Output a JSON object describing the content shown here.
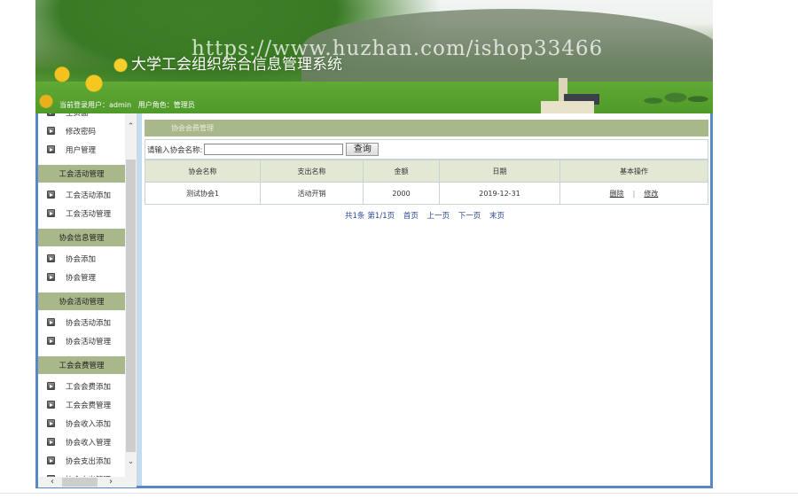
{
  "header": {
    "title": "大学工会组织综合信息管理系统",
    "watermark": "https://www.huzhan.com/ishop33466",
    "user_label": "当前登录用户：",
    "user_name": "admin",
    "role_label": "用户角色：",
    "role_name": "管理员"
  },
  "sidebar": {
    "partial_item": "主页面",
    "groups": [
      {
        "title": null,
        "items": [
          "修改密码",
          "用户管理"
        ]
      },
      {
        "title": "工会活动管理",
        "items": [
          "工会活动添加",
          "工会活动管理"
        ]
      },
      {
        "title": "协会信息管理",
        "items": [
          "协会添加",
          "协会管理"
        ]
      },
      {
        "title": "协会活动管理",
        "items": [
          "协会活动添加",
          "协会活动管理"
        ]
      },
      {
        "title": "工会会费管理",
        "items": [
          "工会会费添加",
          "工会会费管理",
          "协会收入添加",
          "协会收入管理",
          "协会支出添加",
          "协会支出管理"
        ]
      }
    ]
  },
  "main": {
    "panel_title": "协会会费管理",
    "search": {
      "label": "请输入协会名称:",
      "value": "",
      "button": "查询"
    },
    "table": {
      "columns": [
        "协会名称",
        "支出名称",
        "金额",
        "日期",
        "基本操作"
      ],
      "rows": [
        {
          "association": "测试协会1",
          "expense": "活动开销",
          "amount": "2000",
          "date": "2019-12-31",
          "delete": "删除",
          "separator": "|",
          "edit": "修改"
        }
      ]
    },
    "pager": {
      "total": "共1条",
      "page": "第1/1页",
      "first": "首页",
      "prev": "上一页",
      "next": "下一页",
      "last": "末页"
    }
  }
}
